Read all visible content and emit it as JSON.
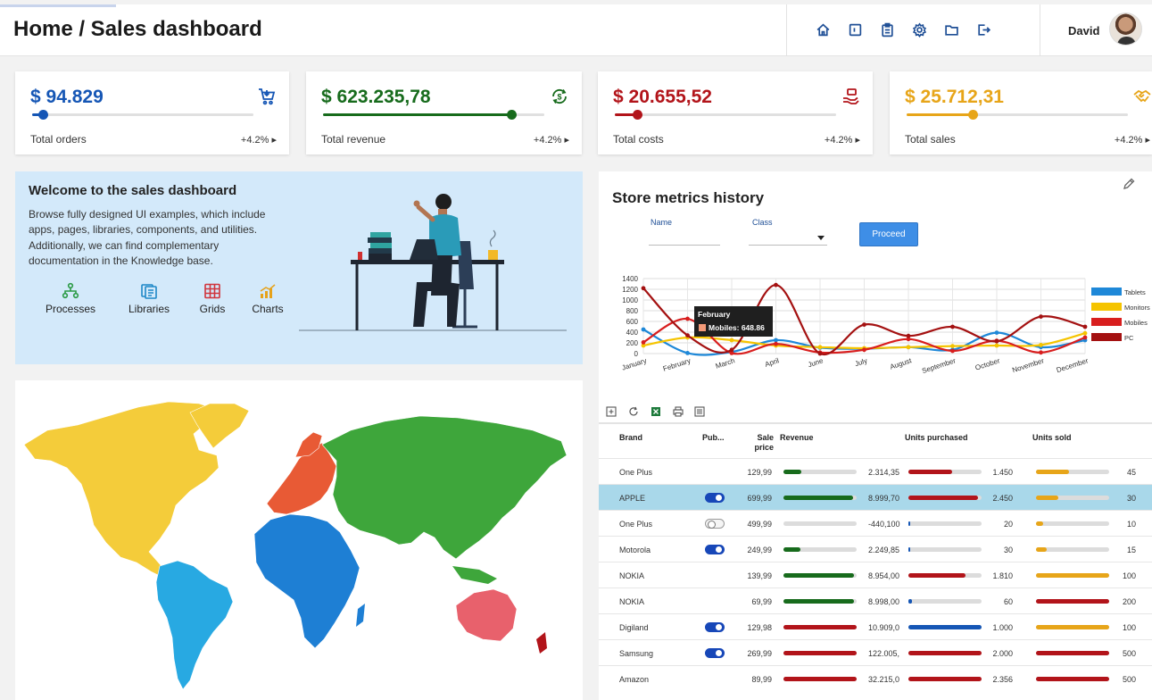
{
  "header": {
    "title": "Home / Sales dashboard",
    "user_name": "David",
    "icons": [
      "home-icon",
      "layout-icon",
      "clipboard-icon",
      "settings-icon",
      "folder-icon",
      "logout-icon"
    ]
  },
  "kpis": [
    {
      "value": "$ 94.829",
      "label": "Total orders",
      "change": "+4.2% ▸",
      "color": "#1556b5",
      "progress": 0.05,
      "icon": "cart-icon"
    },
    {
      "value": "$ 623.235,78",
      "label": "Total revenue",
      "change": "+4.2% ▸",
      "color": "#176b1c",
      "progress": 0.85,
      "icon": "money-refresh-icon"
    },
    {
      "value": "$ 20.655,52",
      "label": "Total costs",
      "change": "+4.2% ▸",
      "color": "#b2141a",
      "progress": 0.1,
      "icon": "hand-money-icon"
    },
    {
      "value": "$ 25.712,31",
      "label": "Total sales",
      "change": "+4.2% ▸",
      "color": "#e7a519",
      "progress": 0.3,
      "icon": "handshake-icon"
    }
  ],
  "welcome": {
    "title": "Welcome to the sales dashboard",
    "body": "Browse fully designed UI examples, which include apps, pages, libraries, components, and utilities. Additionally, we can find complementary documentation in the Knowledge base.",
    "links": [
      {
        "label": "Processes",
        "icon": "process-icon",
        "color": "#2a9a45"
      },
      {
        "label": "Libraries",
        "icon": "library-icon",
        "color": "#1e88c7"
      },
      {
        "label": "Grids",
        "icon": "grid-icon",
        "color": "#d0343c"
      },
      {
        "label": "Charts",
        "icon": "chart-icon",
        "color": "#e6a21a"
      }
    ]
  },
  "map": {
    "region_colors": {
      "north_america": "#f4cc3a",
      "south_america": "#28a9e2",
      "europe": "#e85a35",
      "africa": "#1e7fd4",
      "asia": "#3ea63b",
      "oceania": "#e8616c"
    }
  },
  "metrics": {
    "title": "Store metrics history",
    "form": {
      "name_label": "Name",
      "class_label": "Class",
      "proceed_label": "Proceed"
    },
    "tooltip": {
      "title": "February",
      "label": "Mobiles: 648.86"
    }
  },
  "chart_data": {
    "type": "line",
    "categories": [
      "January",
      "February",
      "March",
      "April",
      "June",
      "July",
      "August",
      "September",
      "October",
      "November",
      "December"
    ],
    "ylim": [
      0,
      1400
    ],
    "yticks": [
      0,
      200,
      400,
      600,
      800,
      1000,
      1200,
      1400
    ],
    "grid": true,
    "legend_position": "right",
    "series": [
      {
        "name": "Tablets",
        "color": "#1e88d8",
        "values": [
          450,
          10,
          30,
          250,
          110,
          90,
          120,
          70,
          390,
          120,
          250
        ]
      },
      {
        "name": "Monitors",
        "color": "#f5c400",
        "values": [
          150,
          300,
          250,
          150,
          120,
          100,
          120,
          140,
          150,
          160,
          380
        ]
      },
      {
        "name": "Mobiles",
        "color": "#d81e1e",
        "values": [
          210,
          649,
          10,
          180,
          20,
          70,
          270,
          50,
          240,
          20,
          300
        ]
      },
      {
        "name": "PC",
        "color": "#a41111",
        "values": [
          1220,
          340,
          70,
          1280,
          0,
          540,
          330,
          500,
          230,
          690,
          500
        ]
      }
    ]
  },
  "table": {
    "toolbar_icons": [
      "add-icon",
      "refresh-icon",
      "excel-icon",
      "print-icon",
      "columns-icon"
    ],
    "columns": {
      "brand": "Brand",
      "published": "Pub...",
      "sale_price": "Sale price",
      "revenue": "Revenue",
      "units_purchased": "Units purchased",
      "units_sold": "Units sold"
    },
    "rows": [
      {
        "brand": "One Plus",
        "published": null,
        "sale_price": "129,99",
        "revenue_bar": 0.24,
        "revenue_color": "#176b1c",
        "revenue": "2.314,35",
        "purchased_bar": 0.6,
        "purchased_color": "#b2141a",
        "purchased": "1.450",
        "sold_bar": 0.45,
        "sold_color": "#e7a519",
        "sold": "45",
        "selected": false
      },
      {
        "brand": "APPLE",
        "published": true,
        "sale_price": "699,99",
        "revenue_bar": 0.95,
        "revenue_color": "#176b1c",
        "revenue": "8.999,70",
        "purchased_bar": 0.95,
        "purchased_color": "#b2141a",
        "purchased": "2.450",
        "sold_bar": 0.3,
        "sold_color": "#e7a519",
        "sold": "30",
        "selected": true
      },
      {
        "brand": "One Plus",
        "published": false,
        "sale_price": "499,99",
        "revenue_bar": 0.0,
        "revenue_color": "#176b1c",
        "revenue": "-440,100",
        "purchased_bar": 0.02,
        "purchased_color": "#1556b5",
        "purchased": "20",
        "sold_bar": 0.1,
        "sold_color": "#e7a519",
        "sold": "10",
        "selected": false
      },
      {
        "brand": "Motorola",
        "published": true,
        "sale_price": "249,99",
        "revenue_bar": 0.23,
        "revenue_color": "#176b1c",
        "revenue": "2.249,85",
        "purchased_bar": 0.03,
        "purchased_color": "#1556b5",
        "purchased": "30",
        "sold_bar": 0.15,
        "sold_color": "#e7a519",
        "sold": "15",
        "selected": false
      },
      {
        "brand": "NOKIA",
        "published": null,
        "sale_price": "139,99",
        "revenue_bar": 0.96,
        "revenue_color": "#176b1c",
        "revenue": "8.954,00",
        "purchased_bar": 0.78,
        "purchased_color": "#b2141a",
        "purchased": "1.810",
        "sold_bar": 1.0,
        "sold_color": "#e7a519",
        "sold": "100",
        "selected": false
      },
      {
        "brand": "NOKIA",
        "published": null,
        "sale_price": "69,99",
        "revenue_bar": 0.96,
        "revenue_color": "#176b1c",
        "revenue": "8.998,00",
        "purchased_bar": 0.05,
        "purchased_color": "#1556b5",
        "purchased": "60",
        "sold_bar": 1.0,
        "sold_color": "#b2141a",
        "sold": "200",
        "selected": false
      },
      {
        "brand": "Digiland",
        "published": true,
        "sale_price": "129,98",
        "revenue_bar": 1.0,
        "revenue_color": "#b2141a",
        "revenue": "10.909,0",
        "purchased_bar": 1.0,
        "purchased_color": "#1556b5",
        "purchased": "1.000",
        "sold_bar": 1.0,
        "sold_color": "#e7a519",
        "sold": "100",
        "selected": false
      },
      {
        "brand": "Samsung",
        "published": true,
        "sale_price": "269,99",
        "revenue_bar": 1.0,
        "revenue_color": "#b2141a",
        "revenue": "122.005,",
        "purchased_bar": 1.0,
        "purchased_color": "#b2141a",
        "purchased": "2.000",
        "sold_bar": 1.0,
        "sold_color": "#b2141a",
        "sold": "500",
        "selected": false
      },
      {
        "brand": "Amazon",
        "published": null,
        "sale_price": "89,99",
        "revenue_bar": 1.0,
        "revenue_color": "#b2141a",
        "revenue": "32.215,0",
        "purchased_bar": 1.0,
        "purchased_color": "#b2141a",
        "purchased": "2.356",
        "sold_bar": 1.0,
        "sold_color": "#b2141a",
        "sold": "500",
        "selected": false
      }
    ]
  }
}
